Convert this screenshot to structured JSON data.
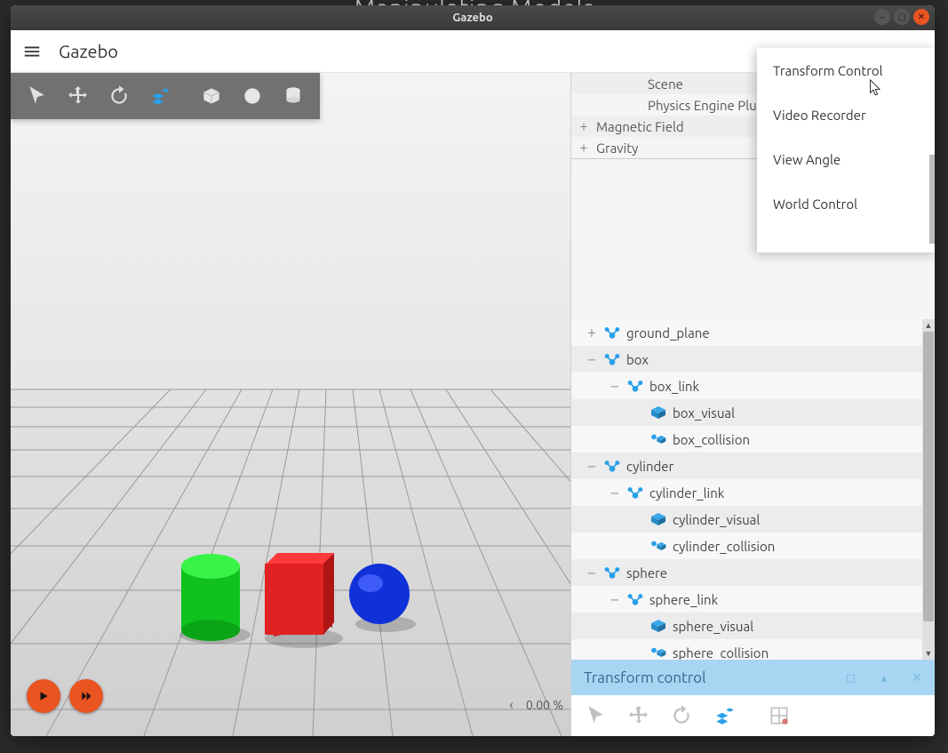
{
  "page_heading": "Manipulating Models",
  "window_title": "Gazebo",
  "app_title": "Gazebo",
  "toolbar": {
    "tools": [
      "select",
      "translate",
      "rotate",
      "scale",
      "box",
      "sphere",
      "cylinder"
    ],
    "active_index": 3
  },
  "plugin_menu": [
    "Transform Control",
    "Video Recorder",
    "View Angle",
    "World Control"
  ],
  "upper_panel": [
    {
      "indent": 1,
      "expander": "",
      "label": "Scene"
    },
    {
      "indent": 1,
      "expander": "",
      "label": "Physics Engine Plugin"
    },
    {
      "indent": 0,
      "expander": "+",
      "label": "Magnetic Field"
    },
    {
      "indent": 0,
      "expander": "+",
      "label": "Gravity"
    }
  ],
  "entities": [
    {
      "depth": 0,
      "exp": "+",
      "icon": "model",
      "label": "ground_plane"
    },
    {
      "depth": 0,
      "exp": "−",
      "icon": "model",
      "label": "box"
    },
    {
      "depth": 1,
      "exp": "−",
      "icon": "link",
      "label": "box_link"
    },
    {
      "depth": 2,
      "exp": "",
      "icon": "visual",
      "label": "box_visual"
    },
    {
      "depth": 2,
      "exp": "",
      "icon": "collision",
      "label": "box_collision"
    },
    {
      "depth": 0,
      "exp": "−",
      "icon": "model",
      "label": "cylinder"
    },
    {
      "depth": 1,
      "exp": "−",
      "icon": "link",
      "label": "cylinder_link"
    },
    {
      "depth": 2,
      "exp": "",
      "icon": "visual",
      "label": "cylinder_visual"
    },
    {
      "depth": 2,
      "exp": "",
      "icon": "collision",
      "label": "cylinder_collision"
    },
    {
      "depth": 0,
      "exp": "−",
      "icon": "model",
      "label": "sphere"
    },
    {
      "depth": 1,
      "exp": "−",
      "icon": "link",
      "label": "sphere_link"
    },
    {
      "depth": 2,
      "exp": "",
      "icon": "visual",
      "label": "sphere_visual"
    },
    {
      "depth": 2,
      "exp": "",
      "icon": "collision",
      "label": "sphere_collision"
    }
  ],
  "tc_title": "Transform control",
  "tc_toolbar_active_index": 3,
  "progress_text": "0.00 %",
  "colors": {
    "cylinder": "#0fdc1e",
    "box": "#e12222",
    "sphere": "#1030d8",
    "accent": "#e95420"
  }
}
